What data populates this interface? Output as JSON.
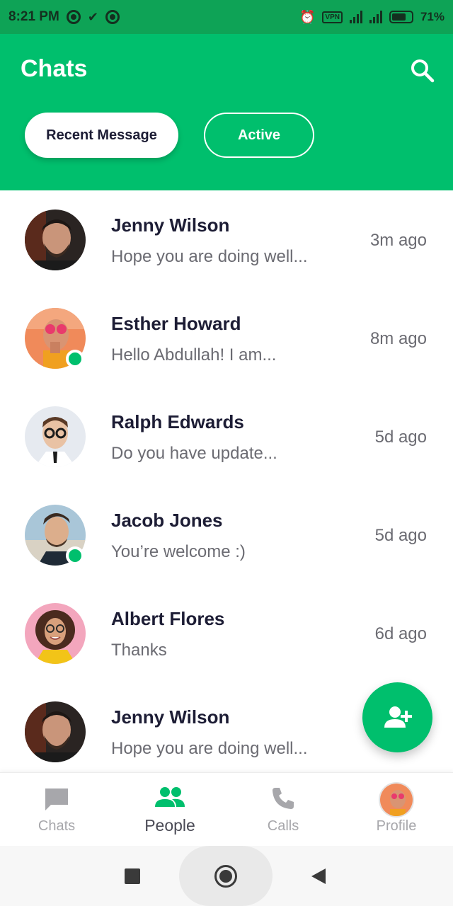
{
  "status_bar": {
    "time": "8:21 PM",
    "vpn_label": "VPN",
    "battery": "71%",
    "left_icons": [
      "at-sign-icon",
      "check-icon",
      "at-sign-icon"
    ],
    "right_icons": [
      "alarm-icon",
      "vpn-icon",
      "signal-icon",
      "signal-icon",
      "battery-charging-icon"
    ]
  },
  "header": {
    "title": "Chats",
    "search_icon": "search-icon",
    "filters": [
      {
        "label": "Recent Message",
        "selected": true
      },
      {
        "label": "Active",
        "selected": false
      }
    ]
  },
  "chats": [
    {
      "name": "Jenny Wilson",
      "preview": "Hope you are doing well...",
      "time": "3m ago",
      "online": false
    },
    {
      "name": "Esther Howard",
      "preview": "Hello Abdullah! I am...",
      "time": "8m ago",
      "online": true
    },
    {
      "name": "Ralph Edwards",
      "preview": "Do you have update...",
      "time": "5d ago",
      "online": false
    },
    {
      "name": "Jacob Jones",
      "preview": "You’re welcome :)",
      "time": "5d ago",
      "online": true
    },
    {
      "name": "Albert Flores",
      "preview": "Thanks",
      "time": "6d ago",
      "online": false
    },
    {
      "name": "Jenny Wilson",
      "preview": "Hope you are doing well...",
      "time": "",
      "online": false
    }
  ],
  "fab": {
    "icon": "add-person-icon"
  },
  "bottom_nav": [
    {
      "label": "Chats",
      "icon": "chat-bubble-icon",
      "active": false
    },
    {
      "label": "People",
      "icon": "people-icon",
      "active": true
    },
    {
      "label": "Calls",
      "icon": "phone-icon",
      "active": false
    },
    {
      "label": "Profile",
      "icon": "profile-avatar",
      "active": false
    }
  ],
  "colors": {
    "primary": "#00BF6D",
    "status_bar": "#0EA356",
    "text_dark": "#1D1D35",
    "text_muted": "#6B6B72",
    "nav_inactive": "#A7A7AB"
  }
}
